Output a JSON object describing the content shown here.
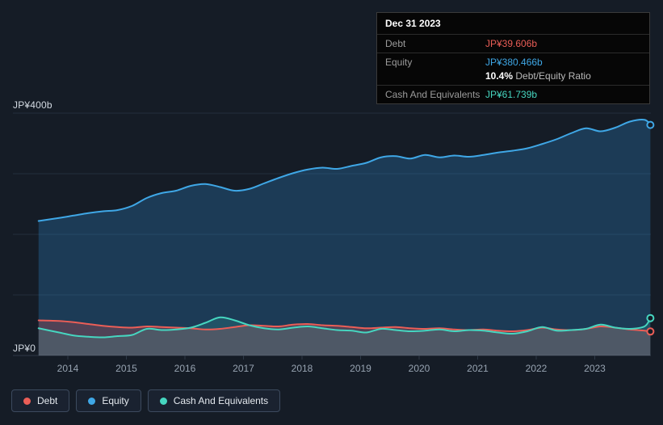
{
  "tooltip": {
    "date": "Dec 31 2023",
    "debt_label": "Debt",
    "debt_value": "JP¥39.606b",
    "equity_label": "Equity",
    "equity_value": "JP¥380.466b",
    "ratio_value": "10.4%",
    "ratio_label": "Debt/Equity Ratio",
    "cash_label": "Cash And Equivalents",
    "cash_value": "JP¥61.739b"
  },
  "axis": {
    "y_top_label": "JP¥400b",
    "y_bottom_label": "JP¥0"
  },
  "legend": [
    {
      "label": "Debt",
      "color": "#eb5e57"
    },
    {
      "label": "Equity",
      "color": "#3fa7e6"
    },
    {
      "label": "Cash And Equivalents",
      "color": "#46d6c0"
    }
  ],
  "colors": {
    "background": "#151c26",
    "grid": "#232e3c",
    "axis_line": "#2e3947",
    "tick_text": "#97a3b1",
    "debt": "#eb5e57",
    "equity": "#3fa7e6",
    "cash": "#46d6c0",
    "equity_fill": "rgba(47,132,199,0.30)",
    "debt_fill": "rgba(214,85,85,0.28)",
    "cash_fill": "rgba(70,214,192,0.15)"
  },
  "chart_data": {
    "type": "area",
    "title": "Debt to Equity history (JP¥ billions)",
    "xlabel": "",
    "ylabel": "JP¥ billions",
    "ylim": [
      0,
      400
    ],
    "x_range": [
      2013.5,
      2023.95
    ],
    "y_gridlines": [
      0,
      100,
      200,
      300,
      400
    ],
    "x_ticks": [
      2014,
      2015,
      2016,
      2017,
      2018,
      2019,
      2020,
      2021,
      2022,
      2023
    ],
    "x": [
      2013.5,
      2013.85,
      2014.1,
      2014.35,
      2014.6,
      2014.85,
      2015.1,
      2015.35,
      2015.6,
      2015.85,
      2016.1,
      2016.35,
      2016.6,
      2016.85,
      2017.1,
      2017.35,
      2017.6,
      2017.85,
      2018.1,
      2018.35,
      2018.6,
      2018.85,
      2019.1,
      2019.35,
      2019.6,
      2019.85,
      2020.1,
      2020.35,
      2020.6,
      2020.85,
      2021.1,
      2021.35,
      2021.6,
      2021.85,
      2022.1,
      2022.35,
      2022.6,
      2022.85,
      2023.1,
      2023.35,
      2023.6,
      2023.85,
      2023.95
    ],
    "series": [
      {
        "name": "Equity",
        "color": "#3fa7e6",
        "values": [
          222,
          227,
          231,
          235,
          238,
          240,
          247,
          260,
          268,
          272,
          280,
          283,
          278,
          272,
          275,
          284,
          293,
          301,
          307,
          310,
          308,
          313,
          318,
          327,
          329,
          325,
          331,
          327,
          330,
          328,
          331,
          335,
          338,
          342,
          349,
          357,
          367,
          375,
          370,
          376,
          386,
          389,
          380.466
        ]
      },
      {
        "name": "Debt",
        "color": "#eb5e57",
        "values": [
          58,
          57,
          55,
          52,
          49,
          47,
          46,
          48,
          47,
          46,
          45,
          43,
          44,
          47,
          50,
          49,
          48,
          51,
          52,
          50,
          49,
          47,
          45,
          46,
          47,
          45,
          44,
          45,
          43,
          42,
          43,
          41,
          40,
          42,
          46,
          43,
          42,
          44,
          48,
          46,
          43,
          41,
          39.606
        ]
      },
      {
        "name": "Cash And Equivalents",
        "color": "#46d6c0",
        "values": [
          45,
          38,
          33,
          31,
          30,
          32,
          34,
          44,
          42,
          43,
          46,
          54,
          63,
          58,
          50,
          45,
          43,
          46,
          48,
          45,
          42,
          41,
          38,
          44,
          42,
          40,
          41,
          43,
          40,
          42,
          41,
          38,
          36,
          40,
          47,
          41,
          42,
          44,
          51,
          46,
          44,
          48,
          61.739
        ]
      }
    ]
  }
}
